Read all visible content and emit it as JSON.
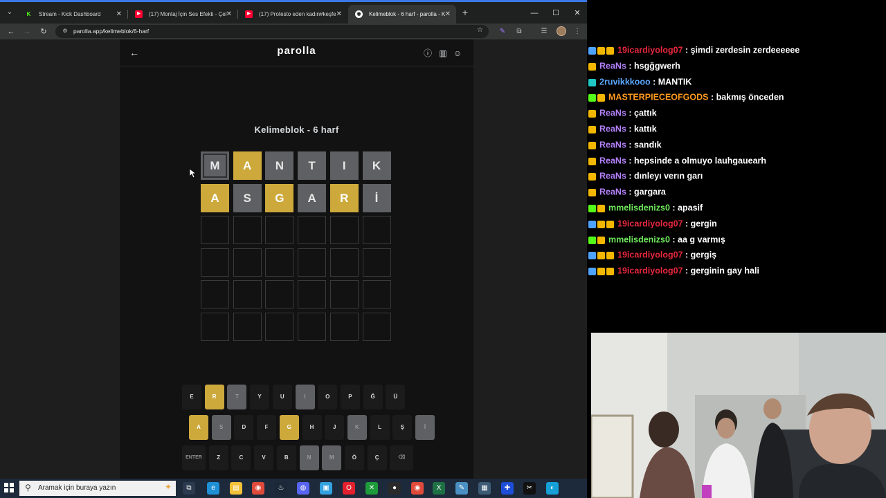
{
  "browser": {
    "tabs": [
      {
        "title": "Stream - Kick Dashboard",
        "fav": "K",
        "fav_color": "#53fc18",
        "active": false
      },
      {
        "title": "(17) Montaj İçin Ses Efekti - Çel",
        "fav": "▶",
        "fav_color": "#ff0033",
        "active": false
      },
      {
        "title": "(17) Protesto eden kadın#keşfe",
        "fav": "▶",
        "fav_color": "#ff0033",
        "active": false
      },
      {
        "title": "Kelimeblok - 6 harf - parolla - K",
        "fav": "◉",
        "fav_color": "#ffffff",
        "active": true
      }
    ],
    "url": "parolla.app/kelimeblok/6-harf"
  },
  "game": {
    "logo": "parolla",
    "subtitle": "Kelimeblok - 6 harf",
    "rows": [
      [
        {
          "l": "M",
          "s": "absent",
          "sel": true
        },
        {
          "l": "A",
          "s": "present"
        },
        {
          "l": "N",
          "s": "absent"
        },
        {
          "l": "T",
          "s": "absent"
        },
        {
          "l": "I",
          "s": "absent"
        },
        {
          "l": "K",
          "s": "absent"
        }
      ],
      [
        {
          "l": "A",
          "s": "present"
        },
        {
          "l": "S",
          "s": "absent"
        },
        {
          "l": "G",
          "s": "present"
        },
        {
          "l": "A",
          "s": "absent"
        },
        {
          "l": "R",
          "s": "present"
        },
        {
          "l": "İ",
          "s": "absent"
        }
      ],
      [
        {
          "l": "",
          "s": "empty"
        },
        {
          "l": "",
          "s": "empty"
        },
        {
          "l": "",
          "s": "empty"
        },
        {
          "l": "",
          "s": "empty"
        },
        {
          "l": "",
          "s": "empty"
        },
        {
          "l": "",
          "s": "empty"
        }
      ],
      [
        {
          "l": "",
          "s": "empty"
        },
        {
          "l": "",
          "s": "empty"
        },
        {
          "l": "",
          "s": "empty"
        },
        {
          "l": "",
          "s": "empty"
        },
        {
          "l": "",
          "s": "empty"
        },
        {
          "l": "",
          "s": "empty"
        }
      ],
      [
        {
          "l": "",
          "s": "empty"
        },
        {
          "l": "",
          "s": "empty"
        },
        {
          "l": "",
          "s": "empty"
        },
        {
          "l": "",
          "s": "empty"
        },
        {
          "l": "",
          "s": "empty"
        },
        {
          "l": "",
          "s": "empty"
        }
      ],
      [
        {
          "l": "",
          "s": "empty"
        },
        {
          "l": "",
          "s": "empty"
        },
        {
          "l": "",
          "s": "empty"
        },
        {
          "l": "",
          "s": "empty"
        },
        {
          "l": "",
          "s": "empty"
        },
        {
          "l": "",
          "s": "empty"
        }
      ]
    ],
    "keyboard": [
      [
        {
          "k": "E",
          "s": ""
        },
        {
          "k": "R",
          "s": "present"
        },
        {
          "k": "T",
          "s": "absent"
        },
        {
          "k": "Y",
          "s": ""
        },
        {
          "k": "U",
          "s": ""
        },
        {
          "k": "I",
          "s": "absent"
        },
        {
          "k": "O",
          "s": ""
        },
        {
          "k": "P",
          "s": ""
        },
        {
          "k": "Ğ",
          "s": ""
        },
        {
          "k": "Ü",
          "s": ""
        }
      ],
      [
        {
          "k": "A",
          "s": "present"
        },
        {
          "k": "S",
          "s": "absent"
        },
        {
          "k": "D",
          "s": ""
        },
        {
          "k": "F",
          "s": ""
        },
        {
          "k": "G",
          "s": "present"
        },
        {
          "k": "H",
          "s": ""
        },
        {
          "k": "J",
          "s": ""
        },
        {
          "k": "K",
          "s": "absent"
        },
        {
          "k": "L",
          "s": ""
        },
        {
          "k": "Ş",
          "s": ""
        },
        {
          "k": "İ",
          "s": "absent"
        }
      ],
      [
        {
          "k": "ENTER",
          "s": "",
          "wide": true
        },
        {
          "k": "Z",
          "s": ""
        },
        {
          "k": "C",
          "s": ""
        },
        {
          "k": "V",
          "s": ""
        },
        {
          "k": "B",
          "s": ""
        },
        {
          "k": "N",
          "s": "absent"
        },
        {
          "k": "M",
          "s": "absent"
        },
        {
          "k": "Ö",
          "s": ""
        },
        {
          "k": "Ç",
          "s": ""
        },
        {
          "k": "⌫",
          "s": "",
          "wide": true
        }
      ]
    ]
  },
  "chat": [
    {
      "user": "19icardiyolog07",
      "color": "#e8283c",
      "badges": [
        "#4da3ff",
        "#f3b700",
        "#f3b700"
      ],
      "msg": "şimdi zerdesin zerdeeeeee"
    },
    {
      "user": "ReaNs",
      "color": "#b482ff",
      "badges": [
        "#f3b700"
      ],
      "msg": "hsgğgwerh"
    },
    {
      "user": "2ruvikkkooo",
      "color": "#5aa7ff",
      "badges": [
        "#1fc7c7"
      ],
      "msg": "MANTIK"
    },
    {
      "user": "MASTERPIECEOFGODS",
      "color": "#ff9a1f",
      "badges": [
        "#53fc18",
        "#f3b700"
      ],
      "msg": "bakmış önceden"
    },
    {
      "user": "ReaNs",
      "color": "#b482ff",
      "badges": [
        "#f3b700"
      ],
      "msg": "çattık"
    },
    {
      "user": "ReaNs",
      "color": "#b482ff",
      "badges": [
        "#f3b700"
      ],
      "msg": "kattık"
    },
    {
      "user": "ReaNs",
      "color": "#b482ff",
      "badges": [
        "#f3b700"
      ],
      "msg": "sandık"
    },
    {
      "user": "ReaNs",
      "color": "#b482ff",
      "badges": [
        "#f3b700"
      ],
      "msg": "hepsinde a olmuyo lauhgauearh"
    },
    {
      "user": "ReaNs",
      "color": "#b482ff",
      "badges": [
        "#f3b700"
      ],
      "msg": "dınleyı verın garı"
    },
    {
      "user": "ReaNs",
      "color": "#b482ff",
      "badges": [
        "#f3b700"
      ],
      "msg": "gargara"
    },
    {
      "user": "mmelisdenizs0",
      "color": "#6ee85b",
      "badges": [
        "#53fc18",
        "#f3b700"
      ],
      "msg": "apasif"
    },
    {
      "user": "19icardiyolog07",
      "color": "#e8283c",
      "badges": [
        "#4da3ff",
        "#f3b700",
        "#f3b700"
      ],
      "msg": "gergin"
    },
    {
      "user": "mmelisdenizs0",
      "color": "#6ee85b",
      "badges": [
        "#53fc18",
        "#f3b700"
      ],
      "msg": "aa g varmış"
    },
    {
      "user": "19icardiyolog07",
      "color": "#e8283c",
      "badges": [
        "#4da3ff",
        "#f3b700",
        "#f3b700"
      ],
      "msg": "gergiş"
    },
    {
      "user": "19icardiyolog07",
      "color": "#e8283c",
      "badges": [
        "#4da3ff",
        "#f3b700",
        "#f3b700"
      ],
      "msg": "gerginin gay hali"
    }
  ],
  "taskbar": {
    "search_placeholder": "Aramak için buraya yazın",
    "apps": [
      {
        "icon": "task-view-icon",
        "color": "#2b3a4e"
      },
      {
        "icon": "edge-icon",
        "color": "#1f8fd6"
      },
      {
        "icon": "file-explorer-icon",
        "color": "#f3c13a"
      },
      {
        "icon": "chrome-icon",
        "color": "#e04a3b"
      },
      {
        "icon": "steam-icon",
        "color": "#1b2838"
      },
      {
        "icon": "discord-icon",
        "color": "#5865f2"
      },
      {
        "icon": "app-icon",
        "color": "#33a1e0"
      },
      {
        "icon": "opera-icon",
        "color": "#e3202d"
      },
      {
        "icon": "xbox-icon",
        "color": "#1e9b3b"
      },
      {
        "icon": "obs-icon",
        "color": "#2a2a2a"
      },
      {
        "icon": "chrome-active-icon",
        "color": "#e04a3b"
      },
      {
        "icon": "excel-icon",
        "color": "#1e7145"
      },
      {
        "icon": "notes-icon",
        "color": "#4a90c2"
      },
      {
        "icon": "calculator-icon",
        "color": "#3d5b75"
      },
      {
        "icon": "app2-icon",
        "color": "#1d4ed8"
      },
      {
        "icon": "capcut-icon",
        "color": "#111111"
      },
      {
        "icon": "app3-icon",
        "color": "#17a0d8"
      }
    ]
  }
}
